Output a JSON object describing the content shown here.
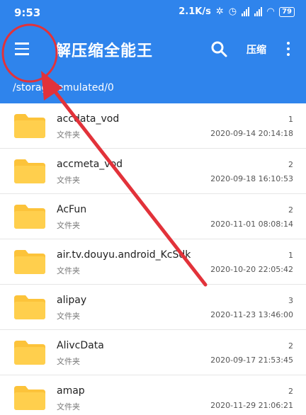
{
  "status_bar": {
    "time": "9:53",
    "net_speed": "2.1K/s",
    "battery": "79"
  },
  "app_bar": {
    "title": "解压缩全能王",
    "compress_label": "压缩",
    "icons": [
      "menu-icon",
      "search-icon",
      "more-vert-icon"
    ]
  },
  "path": {
    "text": "/storage/emulated/0"
  },
  "files": [
    {
      "name": "accdata_vod",
      "type": "文件夹",
      "count": "1",
      "date": "2020-09-14 20:14:18"
    },
    {
      "name": "accmeta_vod",
      "type": "文件夹",
      "count": "2",
      "date": "2020-09-18 16:10:53"
    },
    {
      "name": "AcFun",
      "type": "文件夹",
      "count": "2",
      "date": "2020-11-01 08:08:14"
    },
    {
      "name": "air.tv.douyu.android_KcSdk",
      "type": "文件夹",
      "count": "1",
      "date": "2020-10-20 22:05:42"
    },
    {
      "name": "alipay",
      "type": "文件夹",
      "count": "3",
      "date": "2020-11-23 13:46:00"
    },
    {
      "name": "AlivcData",
      "type": "文件夹",
      "count": "2",
      "date": "2020-09-17 21:53:45"
    },
    {
      "name": "amap",
      "type": "文件夹",
      "count": "2",
      "date": "2020-11-29 21:06:21"
    }
  ],
  "colors": {
    "primary": "#2f84ec",
    "folder": "#fcc33a",
    "annotation": "#e2323a"
  }
}
